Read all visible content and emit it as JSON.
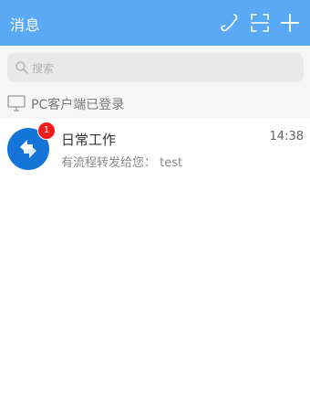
{
  "header": {
    "title": "消息",
    "bg_color": "#5aa9f5",
    "icons": [
      "phone-icon",
      "scan-icon",
      "add-icon"
    ]
  },
  "search": {
    "placeholder": "搜索"
  },
  "pc_status": {
    "text": "PC客户端已登录"
  },
  "conversations": [
    {
      "name": "日常工作",
      "time": "14:38",
      "last_message": "有流程转发给您： test",
      "unread": "1",
      "avatar_color": "#1474d8"
    }
  ]
}
